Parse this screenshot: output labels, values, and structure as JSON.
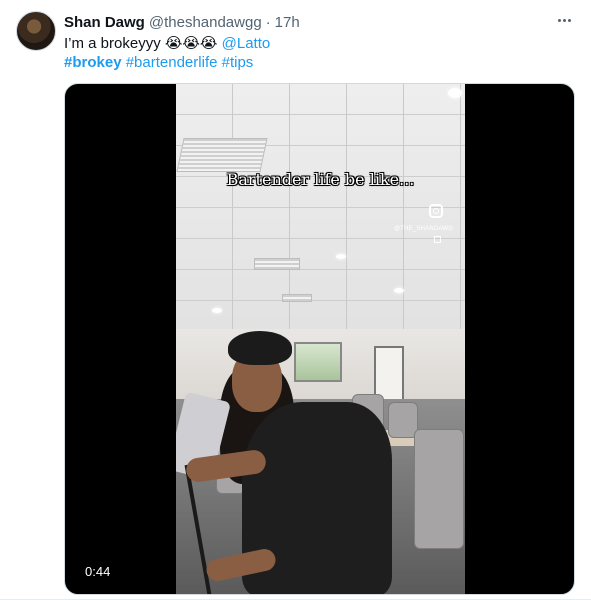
{
  "tweet": {
    "display_name": "Shan Dawg",
    "handle": "@theshandawgg",
    "separator": "·",
    "time": "17h",
    "text_prefix": "I’m a brokeyyy ",
    "emojis": "😭😭😭",
    "mention": "@Latto",
    "hashtags": [
      "#brokey",
      "#bartenderlife",
      "#tips"
    ]
  },
  "video": {
    "caption": "Bartender life be like...",
    "watermark": "@THE_SHANDAWG",
    "duration": "0:44"
  },
  "colors": {
    "link": "#1d9bf0",
    "secondary_text": "#536471",
    "primary_text": "#0f1419"
  },
  "icons": [
    "more-icon",
    "instagram-icon"
  ]
}
